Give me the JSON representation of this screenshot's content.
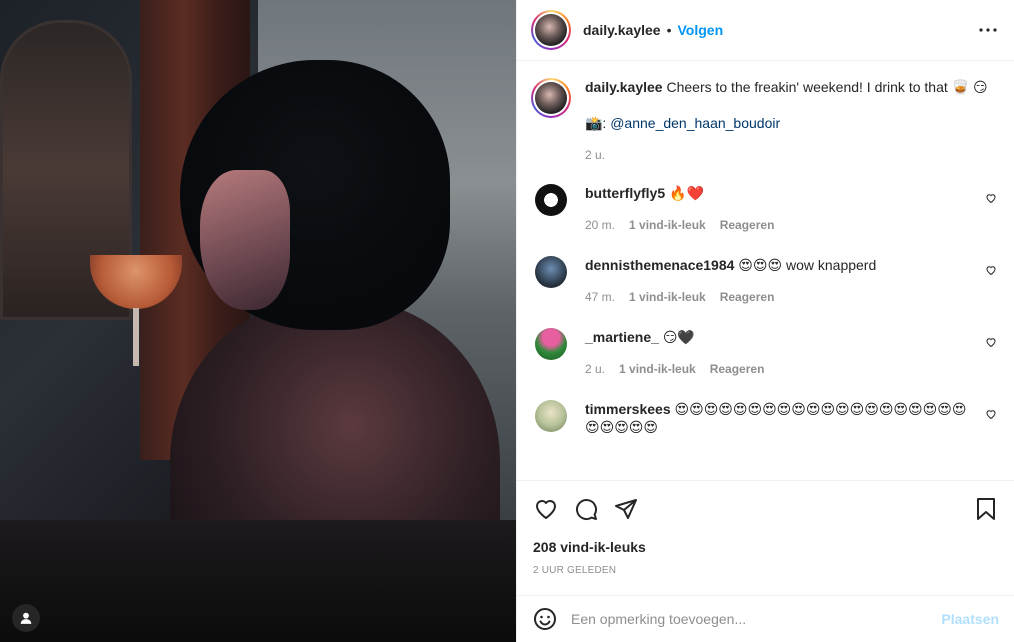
{
  "post": {
    "username": "daily.kaylee",
    "follow_label": "Volgen",
    "separator": "•",
    "caption": {
      "username": "daily.kaylee",
      "text": "Cheers to the freakin' weekend! I drink to that 🥃 😏",
      "credit_prefix": "📸: ",
      "credit_handle": "@anne_den_haan_boudoir",
      "time": "2 u."
    }
  },
  "comments": [
    {
      "username": "butterflyfly5",
      "text": "🔥❤️",
      "time": "20 m.",
      "likes": "1 vind-ik-leuk",
      "reply": "Reageren",
      "avatar_color": "#e8e8e8"
    },
    {
      "username": "dennisthemenace1984",
      "text": "😍😍😍 wow knapperd",
      "time": "47 m.",
      "likes": "1 vind-ik-leuk",
      "reply": "Reageren",
      "avatar_color": "#2d3a4a"
    },
    {
      "username": "_martiene_",
      "text": "😏🖤",
      "time": "2 u.",
      "likes": "1 vind-ik-leuk",
      "reply": "Reageren",
      "avatar_color": "#2f8a3a"
    },
    {
      "username": "timmerskees",
      "text": "😍😍😍😍😍😍😍😍😍😍😍😍😍😍😍😍😍😍😍😍😍😍😍😍😍",
      "time": "",
      "likes": "",
      "reply": "",
      "avatar_color": "#b7c39a"
    }
  ],
  "actions": {
    "likes": "208 vind-ik-leuks",
    "date": "2 UUR GELEDEN"
  },
  "add_comment": {
    "placeholder": "Een opmerking toevoegen...",
    "post_label": "Plaatsen"
  }
}
